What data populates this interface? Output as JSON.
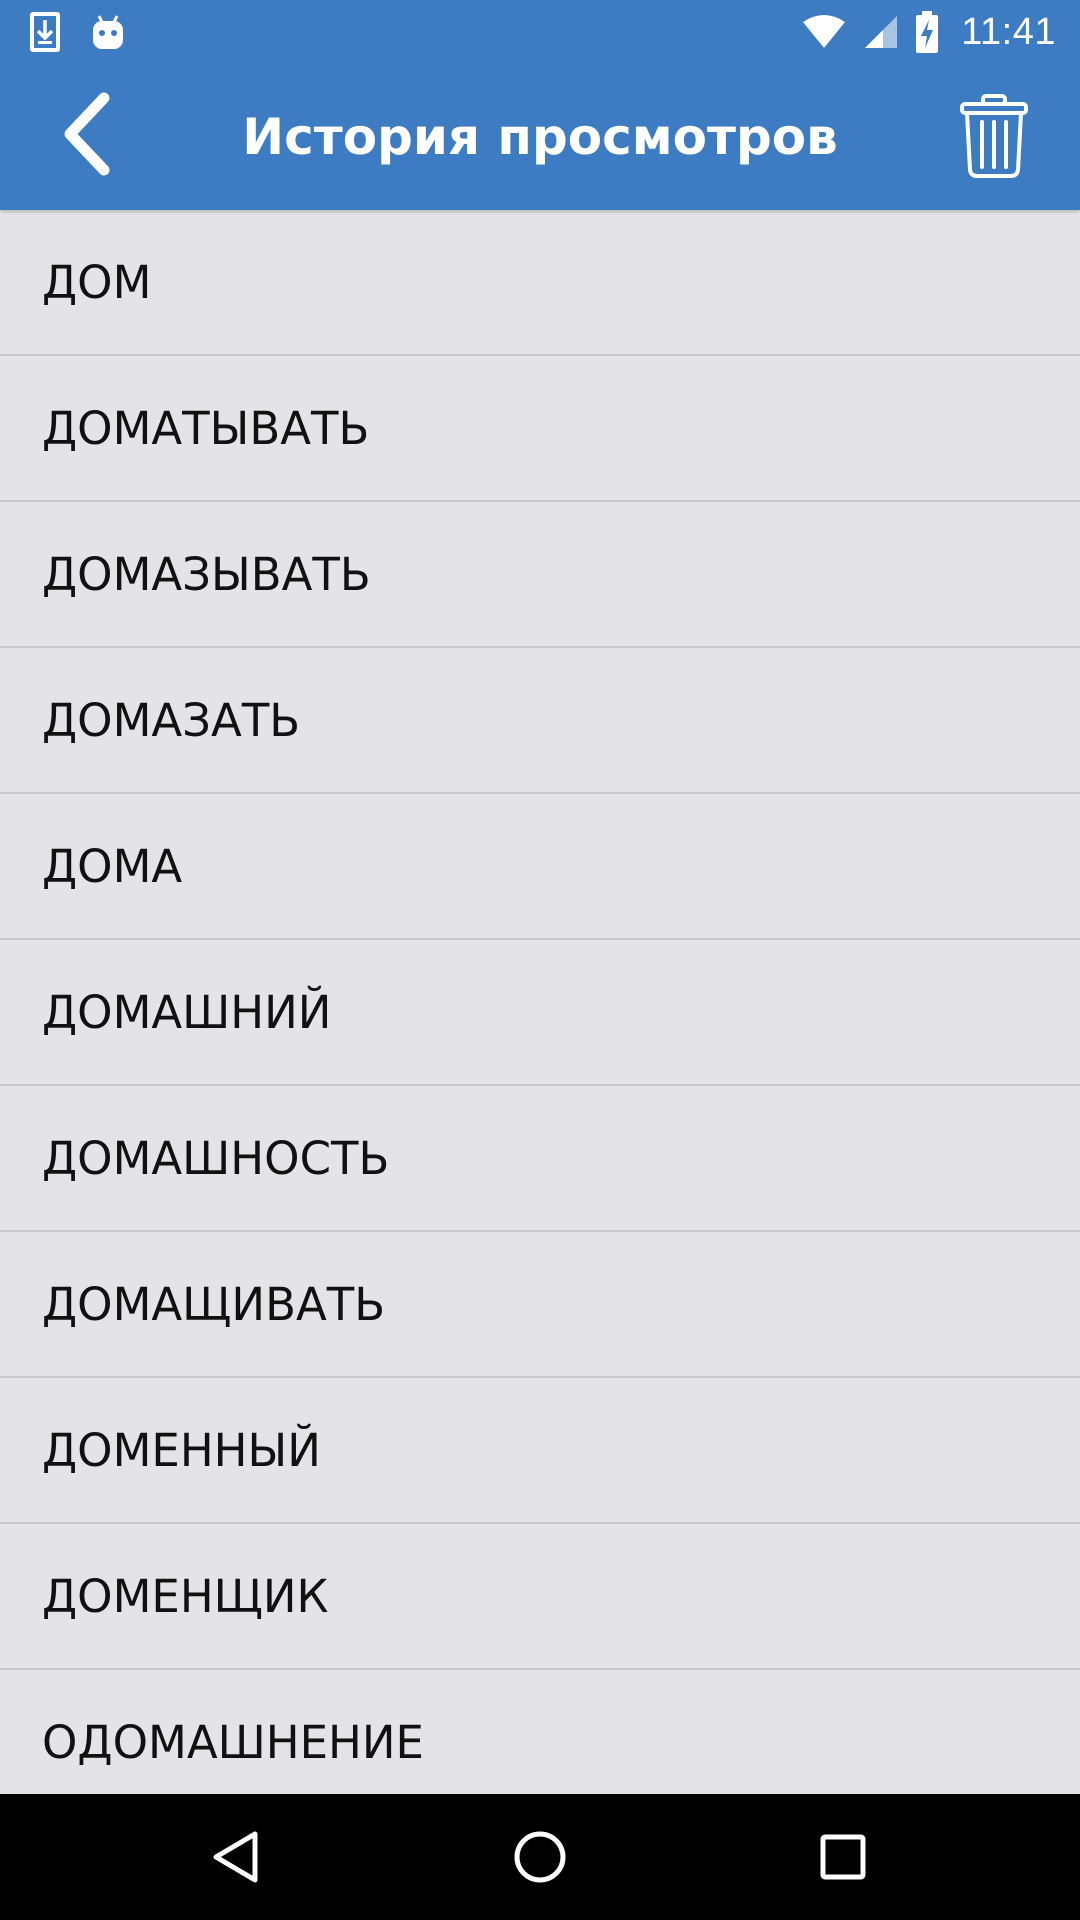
{
  "status_bar": {
    "time": "11:41",
    "left_icons": [
      "download-icon",
      "android-icon"
    ],
    "right_icons": [
      "wifi-icon",
      "cell-signal-icon",
      "battery-charging-icon"
    ]
  },
  "app_bar": {
    "title": "История просмотров",
    "back_icon": "chevron-left-icon",
    "action_icon": "trash-icon",
    "color": "#3d7cc2"
  },
  "history": {
    "items": [
      "ДОМ",
      "ДОМАТЫВАТЬ",
      "ДОМАЗЫВАТЬ",
      "ДОМАЗАТЬ",
      "ДОМА",
      "ДОМАШНИЙ",
      "ДОМАШНОСТЬ",
      "ДОМАЩИВАТЬ",
      "ДОМЕННЫЙ",
      "ДОМЕНЩИК",
      "ОДОМАШНЕНИЕ"
    ]
  },
  "nav_bar": {
    "buttons": [
      "nav-back-icon",
      "nav-home-icon",
      "nav-recents-icon"
    ]
  }
}
